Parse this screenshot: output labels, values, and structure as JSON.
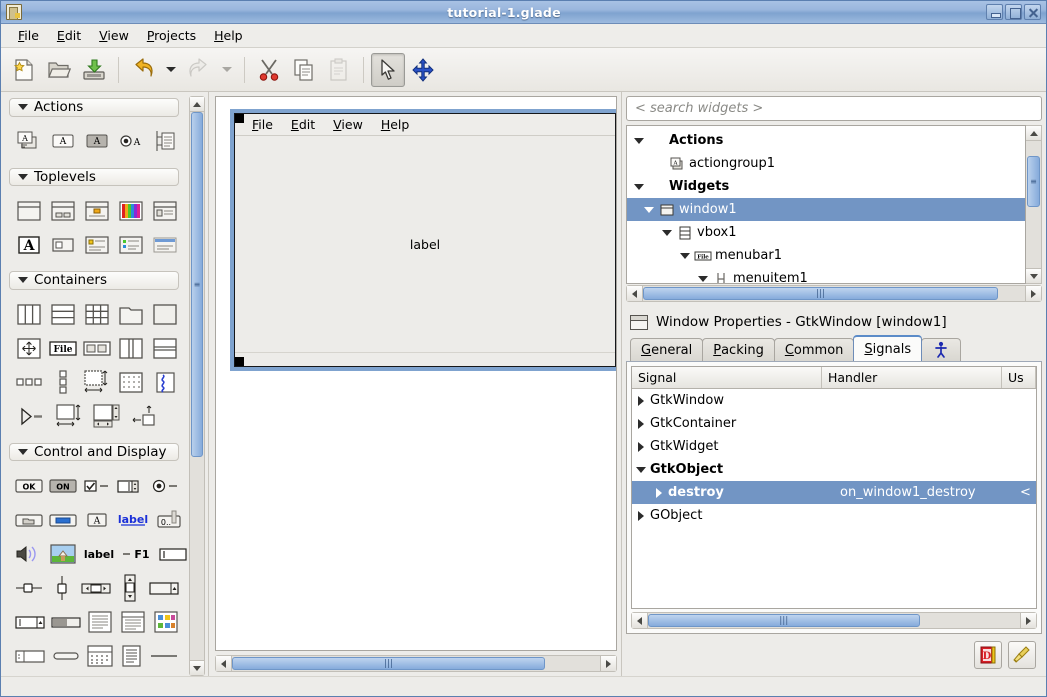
{
  "window": {
    "title": "tutorial-1.glade",
    "app_icon": "glade-file-icon",
    "minimize": "minimize-button",
    "maximize": "maximize-button",
    "close": "close-button"
  },
  "menubar": {
    "items": [
      {
        "label": "File",
        "accel": "F"
      },
      {
        "label": "Edit",
        "accel": "E"
      },
      {
        "label": "View",
        "accel": "V"
      },
      {
        "label": "Projects",
        "accel": "P"
      },
      {
        "label": "Help",
        "accel": "H"
      }
    ]
  },
  "toolbar": {
    "buttons": [
      {
        "name": "new-project-button",
        "icon": "new-document-icon",
        "enabled": true
      },
      {
        "name": "open-project-button",
        "icon": "open-folder-icon",
        "enabled": true
      },
      {
        "name": "save-project-button",
        "icon": "save-disk-icon",
        "enabled": true
      },
      {
        "name": "undo-button",
        "icon": "undo-arrow-icon",
        "enabled": true
      },
      {
        "name": "undo-dropdown",
        "icon": "chevron-down-icon",
        "enabled": true
      },
      {
        "name": "redo-button",
        "icon": "redo-arrow-icon",
        "enabled": false
      },
      {
        "name": "redo-dropdown",
        "icon": "chevron-down-icon",
        "enabled": false
      },
      {
        "name": "cut-button",
        "icon": "scissors-icon",
        "enabled": true
      },
      {
        "name": "copy-button",
        "icon": "copy-pages-icon",
        "enabled": true
      },
      {
        "name": "paste-button",
        "icon": "clipboard-icon",
        "enabled": false
      },
      {
        "name": "pointer-mode-button",
        "icon": "mouse-pointer-icon",
        "enabled": true,
        "selected": true
      },
      {
        "name": "drag-resize-mode-button",
        "icon": "move-arrows-icon",
        "enabled": true
      }
    ]
  },
  "palette": {
    "groups": [
      {
        "title": "Actions",
        "expanded": true,
        "rows": [
          [
            "action-group-icon",
            "action-icon",
            "toggle-action-icon",
            "radio-action-icon",
            "recent-action-icon"
          ]
        ]
      },
      {
        "title": "Toplevels",
        "expanded": true,
        "rows": [
          [
            "window-icon",
            "dialog-icon",
            "message-dialog-icon",
            "color-selection-dialog-icon",
            "file-chooser-dialog-icon"
          ],
          [
            "font-selection-dialog-icon",
            "input-dialog-icon",
            "about-dialog-icon",
            "assistant-icon",
            "offscreen-window-icon"
          ]
        ]
      },
      {
        "title": "Containers",
        "expanded": true,
        "rows": [
          [
            "hbox-icon",
            "vbox-icon",
            "table-icon",
            "notebook-icon",
            "frame-icon"
          ],
          [
            "alignment-icon",
            "menubar-icon",
            "hbutton-box-icon",
            "hpaned-icon",
            "vpaned-icon"
          ],
          [
            "hbutton-row-icon",
            "vbutton-col-icon",
            "fixed-icon",
            "layout-icon",
            "expander-icon"
          ],
          [
            "arrow-separator-icon",
            "aspect-frame-icon",
            "scrolled-window-icon",
            "viewport-icon"
          ]
        ]
      },
      {
        "title": "Control and Display",
        "expanded": true,
        "rows": [
          [
            "button-ok-icon",
            "toggle-button-icon",
            "check-button-icon",
            "spin-button-icon",
            "radio-button-icon"
          ],
          [
            "file-chooser-button-icon",
            "color-button-icon",
            "font-button-icon",
            "link-button-icon",
            "scale-button-icon"
          ],
          [
            "volume-button-icon",
            "image-icon",
            "label-icon",
            "accel-label-icon",
            "entry-icon"
          ],
          [
            "hscrollbar-icon",
            "vscale-icon",
            "hscrollbar-wide-icon",
            "vscrollbar-icon",
            "combo-box-icon"
          ],
          [
            "combo-box-entry-icon",
            "progress-bar-icon",
            "text-view-icon",
            "tree-view-icon",
            "icon-view-icon"
          ],
          [
            "statusbar-icon",
            "hseparator-pill-icon",
            "calendar-icon",
            "list-icon",
            "hseparator-icon"
          ]
        ]
      }
    ]
  },
  "canvas": {
    "design_window": {
      "menubar": [
        "File",
        "Edit",
        "View",
        "Help"
      ],
      "center_label": "label"
    },
    "hscroll_grip": "|||"
  },
  "widget_tree": {
    "search_placeholder": "< search widgets >",
    "nodes": [
      {
        "indent": 0,
        "expander": "down",
        "icon": null,
        "label": "Actions",
        "bold": true,
        "selected": false
      },
      {
        "indent": 1,
        "expander": null,
        "icon": "action-group-icon",
        "label": "actiongroup1",
        "bold": false,
        "selected": false
      },
      {
        "indent": 0,
        "expander": "down",
        "icon": null,
        "label": "Widgets",
        "bold": true,
        "selected": false
      },
      {
        "indent": 1,
        "expander": "down",
        "icon": "window-icon",
        "label": "window1",
        "bold": false,
        "selected": true
      },
      {
        "indent": 2,
        "expander": "down",
        "icon": "vbox-icon",
        "label": "vbox1",
        "bold": false,
        "selected": false
      },
      {
        "indent": 3,
        "expander": "down",
        "icon": "menubar-icon",
        "label": "menubar1",
        "bold": false,
        "selected": false
      },
      {
        "indent": 4,
        "expander": "down",
        "icon": "menuitem-icon",
        "label": "menuitem1",
        "bold": false,
        "selected": false
      }
    ],
    "hscroll_grip": "|||"
  },
  "properties": {
    "header": "Window Properties - GtkWindow [window1]",
    "header_icon": "window-icon",
    "tabs": [
      {
        "label": "General",
        "accel": "G",
        "active": false
      },
      {
        "label": "Packing",
        "accel": "P",
        "active": false
      },
      {
        "label": "Common",
        "accel": "C",
        "active": false
      },
      {
        "label": "Signals",
        "accel": "S",
        "active": true
      },
      {
        "label": "",
        "icon": "accessibility-icon",
        "active": false
      }
    ]
  },
  "signals": {
    "columns": [
      "Signal",
      "Handler",
      "Us"
    ],
    "rows": [
      {
        "expander": "right",
        "signal": "GtkWindow",
        "handler": "",
        "user": "",
        "bold": false,
        "selected": false,
        "indent": 0
      },
      {
        "expander": "right",
        "signal": "GtkContainer",
        "handler": "",
        "user": "",
        "bold": false,
        "selected": false,
        "indent": 0
      },
      {
        "expander": "right",
        "signal": "GtkWidget",
        "handler": "",
        "user": "",
        "bold": false,
        "selected": false,
        "indent": 0
      },
      {
        "expander": "down",
        "signal": "GtkObject",
        "handler": "",
        "user": "",
        "bold": true,
        "selected": false,
        "indent": 0
      },
      {
        "expander": "right",
        "signal": "destroy",
        "handler": "on_window1_destroy",
        "user": "<",
        "bold": true,
        "selected": true,
        "indent": 1
      },
      {
        "expander": "right",
        "signal": "GObject",
        "handler": "",
        "user": "",
        "bold": false,
        "selected": false,
        "indent": 0
      }
    ],
    "hscroll_grip": "|||"
  },
  "footer": {
    "buttons": [
      {
        "name": "devhelp-button",
        "icon": "devhelp-book-icon"
      },
      {
        "name": "clear-button",
        "icon": "broom-icon"
      }
    ]
  },
  "colors": {
    "selection_blue": "#7295c4",
    "titlebar_blue": "#9ab6dd",
    "scrollbar_blue": "#86abdb",
    "panel_bg": "#edece9",
    "canvas_white": "#ffffff",
    "design_frame": "#7fa3cf"
  }
}
